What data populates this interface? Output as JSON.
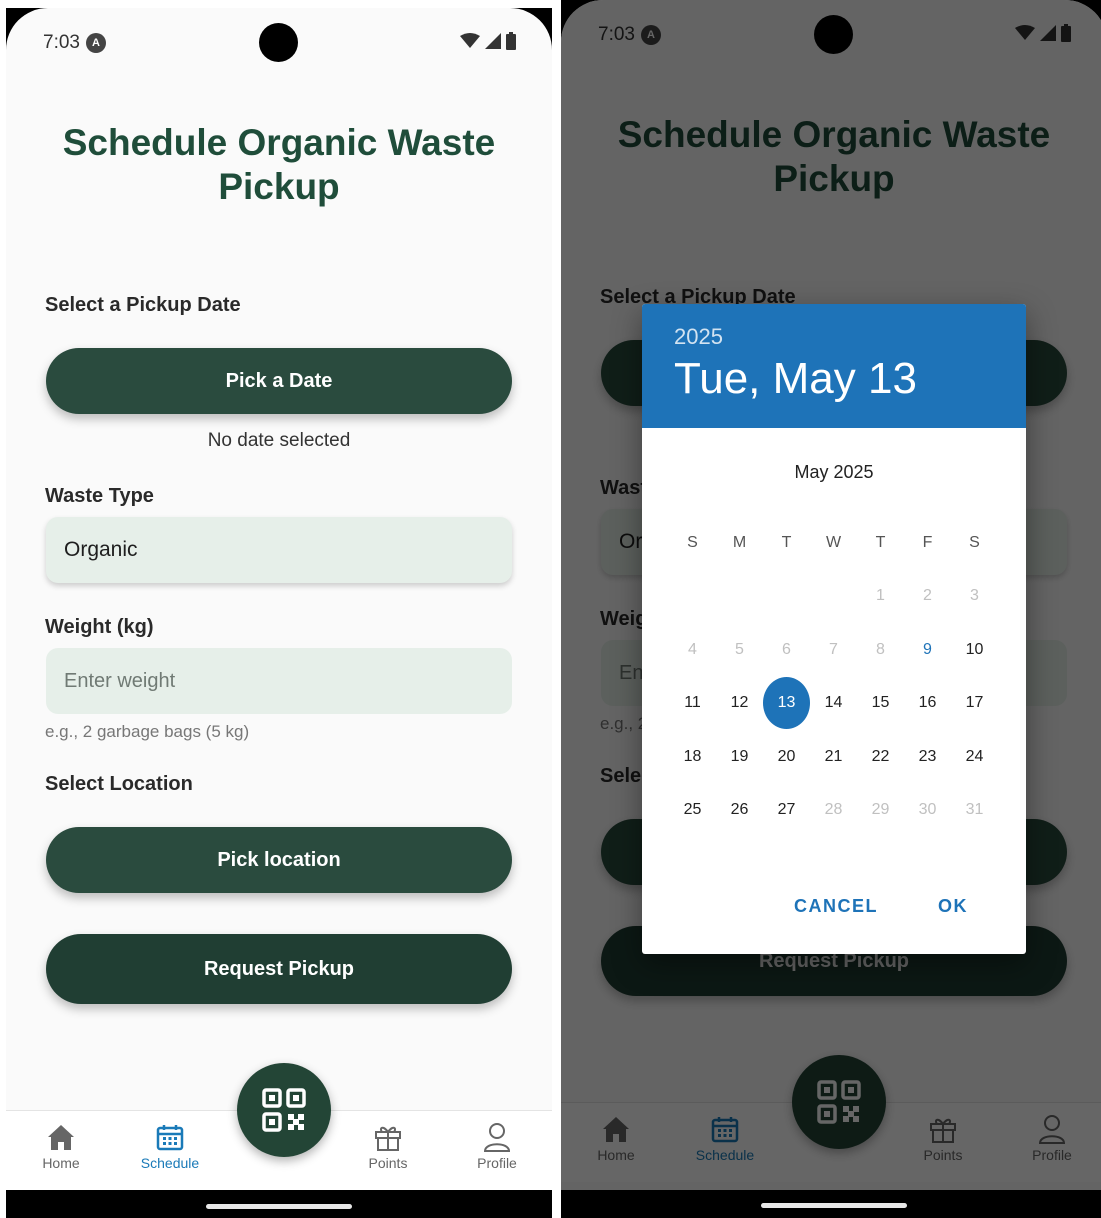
{
  "status": {
    "time": "7:03",
    "badge": "A"
  },
  "screen": {
    "title": "Schedule Organic Waste Pickup",
    "pickup_date_label": "Select a Pickup Date",
    "pick_date_button": "Pick a Date",
    "date_status": "No date selected",
    "waste_type_label": "Waste Type",
    "waste_type_value": "Organic",
    "weight_label": "Weight (kg)",
    "weight_placeholder": "Enter weight",
    "weight_hint": "e.g., 2 garbage bags (5 kg)",
    "location_label": "Select Location",
    "pick_location_button": "Pick location",
    "request_button": "Request Pickup"
  },
  "nav": {
    "items": [
      {
        "label": "Home",
        "icon": "home-icon"
      },
      {
        "label": "Schedule",
        "icon": "calendar-icon"
      },
      {
        "label": "Points",
        "icon": "gift-icon"
      },
      {
        "label": "Profile",
        "icon": "person-icon"
      }
    ],
    "fab_icon": "qr-code-icon",
    "active": "Schedule"
  },
  "dialog": {
    "year": "2025",
    "selected_date": "Tue, May 13",
    "month_title": "May 2025",
    "weekdays": [
      "S",
      "M",
      "T",
      "W",
      "T",
      "F",
      "S"
    ],
    "weeks": [
      [
        "",
        "",
        "",
        "",
        "1",
        "2",
        "3"
      ],
      [
        "4",
        "5",
        "6",
        "7",
        "8",
        "9",
        "10"
      ],
      [
        "11",
        "12",
        "13",
        "14",
        "15",
        "16",
        "17"
      ],
      [
        "18",
        "19",
        "20",
        "21",
        "22",
        "23",
        "24"
      ],
      [
        "25",
        "26",
        "27",
        "28",
        "29",
        "30",
        "31"
      ]
    ],
    "selected_day": "13",
    "today": "9",
    "cancel": "CANCEL",
    "ok": "OK"
  },
  "colors": {
    "primary_green": "#2a4b3e",
    "title_green": "#1f4d3a",
    "picker_blue": "#1e73b8",
    "field_bg": "#e6efe9"
  }
}
